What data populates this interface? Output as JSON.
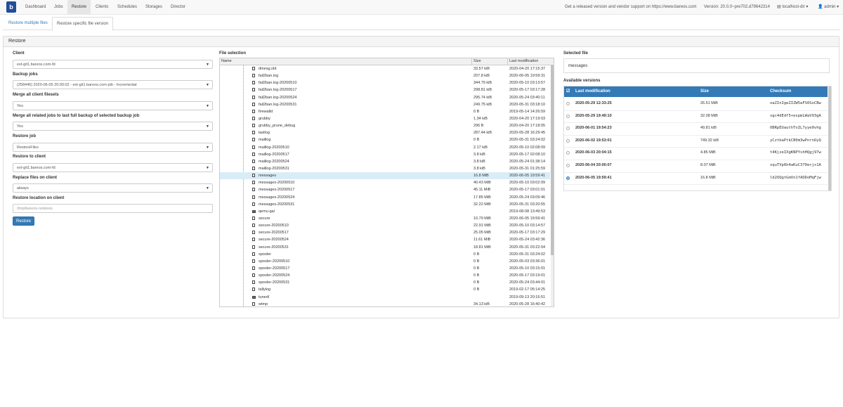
{
  "navbar": {
    "brand": "b",
    "items": [
      "Dashboard",
      "Jobs",
      "Restore",
      "Clients",
      "Schedules",
      "Storages",
      "Director"
    ],
    "active": "Restore",
    "notice": "Get a released version and vendor support on https://www.bareos.com",
    "version": "Version: 20.0.0~pre702.d79642314",
    "director": "localhost-dir",
    "user": "admin"
  },
  "tabs": [
    "Restore multiple files",
    "Restore specific file version"
  ],
  "panel_title": "Restore",
  "form": {
    "client_label": "Client",
    "client_value": "ext-git1.bareos.com-fd",
    "backup_jobs_label": "Backup jobs",
    "backup_jobs_value": "(258446) 2020-06-05 20:00:02 - ext-git1.bareos.com-job - Incremental",
    "merge_filesets_label": "Merge all client filesets",
    "merge_filesets_value": "Yes",
    "merge_related_label": "Merge all related jobs to last full backup of selected backup job",
    "merge_related_value": "Yes",
    "restore_job_label": "Restore job",
    "restore_job_value": "RestoreFiles",
    "restore_client_label": "Restore to client",
    "restore_client_value": "ext-git1.bareos.com-fd",
    "replace_label": "Replace files on client",
    "replace_value": "always",
    "location_label": "Restore location on client",
    "location_placeholder": "/tmp/bareos-restores",
    "restore_button": "Restore"
  },
  "file_selection": {
    "title": "File selection",
    "columns": [
      "Name",
      "Size",
      "Last modification"
    ],
    "rows": [
      {
        "name": "dmesg.old",
        "size": "33.57 kiB",
        "date": "2020-04-20 17:15:37",
        "dir": false
      },
      {
        "name": "fail2ban.log",
        "size": "207.8 kiB",
        "date": "2020-06-05 19:59:31",
        "dir": false
      },
      {
        "name": "fail2ban.log-20200510",
        "size": "344.79 kiB",
        "date": "2020-05-10 03:13:57",
        "dir": false
      },
      {
        "name": "fail2ban.log-20200517",
        "size": "298.81 kiB",
        "date": "2020-05-17 03:17:28",
        "dir": false
      },
      {
        "name": "fail2ban.log-20200524",
        "size": "295.74 kiB",
        "date": "2020-05-24 03:40:11",
        "dir": false
      },
      {
        "name": "fail2ban.log-20200531",
        "size": "249.75 kiB",
        "date": "2020-05-31 03:18:10",
        "dir": false
      },
      {
        "name": "firewalld",
        "size": "0 B",
        "date": "2019-05-14 14:26:59",
        "dir": false
      },
      {
        "name": "grubby",
        "size": "1.34 kiB",
        "date": "2020-04-20 17:19:03",
        "dir": false
      },
      {
        "name": "grubby_prune_debug",
        "size": "296 B",
        "date": "2020-04-20 17:18:05",
        "dir": false
      },
      {
        "name": "lastlog",
        "size": "287.44 kiB",
        "date": "2020-05-28 16:29:45",
        "dir": false
      },
      {
        "name": "maillog",
        "size": "0 B",
        "date": "2020-05-31 03:24:02",
        "dir": false
      },
      {
        "name": "maillog-20200510",
        "size": "2.17 kiB",
        "date": "2020-05-10 02:08:09",
        "dir": false
      },
      {
        "name": "maillog-20200517",
        "size": "3.8 kiB",
        "date": "2020-05-17 02:08:10",
        "dir": false
      },
      {
        "name": "maillog-20200524",
        "size": "3.8 kiB",
        "date": "2020-05-24 01:38:14",
        "dir": false
      },
      {
        "name": "maillog-20200531",
        "size": "3.8 kiB",
        "date": "2020-05-31 01:25:59",
        "dir": false
      },
      {
        "name": "messages",
        "size": "16.8 MiB",
        "date": "2020-06-05 19:59:41",
        "dir": false,
        "selected": true
      },
      {
        "name": "messages-20200510",
        "size": "40.43 MiB",
        "date": "2020-05-10 03:02:09",
        "dir": false
      },
      {
        "name": "messages-20200517",
        "size": "45.11 MiB",
        "date": "2020-05-17 03:01:01",
        "dir": false
      },
      {
        "name": "messages-20200524",
        "size": "17.85 MiB",
        "date": "2020-05-24 03:09:46",
        "dir": false
      },
      {
        "name": "messages-20200531",
        "size": "32.22 MiB",
        "date": "2020-05-31 03:20:55",
        "dir": false
      },
      {
        "name": "qemu-ga/",
        "size": "",
        "date": "2019-08-08 13:49:53",
        "dir": true
      },
      {
        "name": "secure",
        "size": "10.79 MiB",
        "date": "2020-06-05 19:59:41",
        "dir": false
      },
      {
        "name": "secure-20200510",
        "size": "22.91 MiB",
        "date": "2020-05-10 03:14:57",
        "dir": false
      },
      {
        "name": "secure-20200517",
        "size": "25.05 MiB",
        "date": "2020-05-17 03:17:29",
        "dir": false
      },
      {
        "name": "secure-20200524",
        "size": "11.61 MiB",
        "date": "2020-05-24 03:42:36",
        "dir": false
      },
      {
        "name": "secure-20200531",
        "size": "18.81 MiB",
        "date": "2020-05-31 03:22:04",
        "dir": false
      },
      {
        "name": "spooler",
        "size": "0 B",
        "date": "2020-05-31 03:24:02",
        "dir": false
      },
      {
        "name": "spooler-20200510",
        "size": "0 B",
        "date": "2020-05-03 03:36:01",
        "dir": false
      },
      {
        "name": "spooler-20200517",
        "size": "0 B",
        "date": "2020-05-10 03:15:01",
        "dir": false
      },
      {
        "name": "spooler-20200524",
        "size": "0 B",
        "date": "2020-05-17 03:19:01",
        "dir": false
      },
      {
        "name": "spooler-20200531",
        "size": "0 B",
        "date": "2020-05-24 03:44:01",
        "dir": false
      },
      {
        "name": "tallylog",
        "size": "0 B",
        "date": "2019-02-17 05:14:25",
        "dir": false
      },
      {
        "name": "tuned/",
        "size": "",
        "date": "2019-09-13 20:16:51",
        "dir": true
      },
      {
        "name": "wtmp",
        "size": "34.13 kiB",
        "date": "2020-05-28 16:40:42",
        "dir": false
      }
    ]
  },
  "selected_file": {
    "title": "Selected file",
    "value": "messages"
  },
  "versions": {
    "title": "Available versions",
    "columns": [
      "Last modification",
      "Size",
      "Checksum"
    ],
    "rows": [
      {
        "date": "2020-05-29 12:33:25",
        "size": "26.51 MiB",
        "checksum": "oaZInIgeZIZW5aFS0SoCBw",
        "selected": false
      },
      {
        "date": "2020-05-29 19:49:10",
        "size": "32.08 MiB",
        "checksum": "vgc4dEdf5+espmLWaV93gA",
        "selected": false
      },
      {
        "date": "2020-06-01 19:54:23",
        "size": "49.81 kiB",
        "checksum": "OBRpEUauthToIL7yye0vhg",
        "selected": false
      },
      {
        "date": "2020-06-02 19:53:01",
        "size": "749.32 kiB",
        "checksum": "yCztbaPtkCB0m3wPnrnOyQ",
        "selected": false
      },
      {
        "date": "2020-06-03 20:04:15",
        "size": "4.85 MiB",
        "checksum": "t4KjzeIXgKNPYshHQgj97w",
        "selected": false
      },
      {
        "date": "2020-06-04 20:00:07",
        "size": "8.07 MiB",
        "checksum": "xquTVp6h4aKuC370e+jx1A",
        "selected": false
      },
      {
        "date": "2020-06-05 19:59:41",
        "size": "16.8 MiB",
        "checksum": "ld2OQgtGmVn1fADDoMqFjw",
        "selected": true
      }
    ]
  },
  "colors": {
    "accent": "#337ab7",
    "selected_row": "#d9edf7"
  }
}
